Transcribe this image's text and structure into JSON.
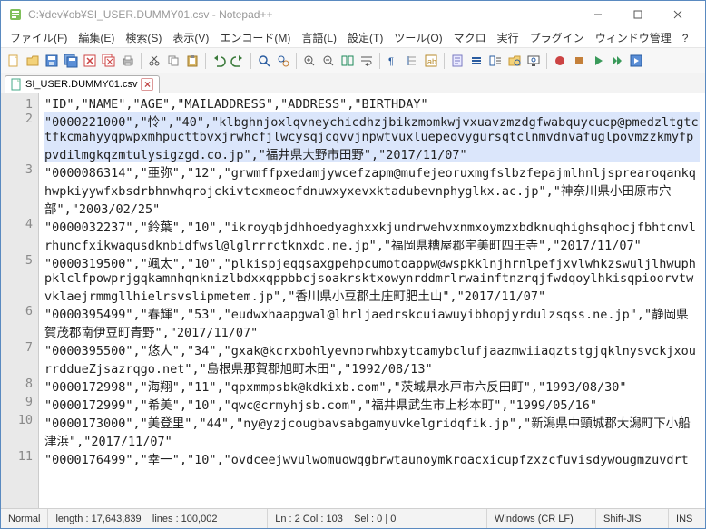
{
  "window": {
    "title": "C:¥dev¥ob¥SI_USER.DUMMY01.csv - Notepad++"
  },
  "menu": {
    "file": "ファイル(F)",
    "edit": "編集(E)",
    "search": "検索(S)",
    "view": "表示(V)",
    "encoding": "エンコード(M)",
    "language": "言語(L)",
    "settings": "設定(T)",
    "tools": "ツール(O)",
    "macro": "マクロ",
    "run": "実行",
    "plugins": "プラグイン",
    "window": "ウィンドウ管理",
    "help": "?"
  },
  "tab": {
    "name": "SI_USER.DUMMY01.csv"
  },
  "lines": [
    {
      "n": "1",
      "text": "\"ID\",\"NAME\",\"AGE\",\"MAILADDRESS\",\"ADDRESS\",\"BIRTHDAY\""
    },
    {
      "n": "2",
      "text": "\"0000221000\",\"怜\",\"40\",\"klbghnjoxlqvneychicdhzjbikzmomkwjvxuavzmzdgfwabquycucp@pmedzltgtctfkcmahyyqpwpxmhpucttbvxjrwhcfjlwcysqjcqvvjnpwtvuxluepeovygursqtclnmvdnvafuglpovmzzkmyfppvdilmgkqzmtulysigzgd.co.jp\",\"福井県大野市田野\",\"2017/11/07\"",
      "selected": true
    },
    {
      "n": "3",
      "text": "\"0000086314\",\"亜弥\",\"12\",\"grwmffpxedamjywcefzapm@mufejeoruxmgfslbzfepajmlhnljsprearoqankqhwpkiyywfxbsdrbhnwhqrojckivtcxmeocfdnuwxyxevxktadubevnphyglkx.ac.jp\",\"神奈川県小田原市穴部\",\"2003/02/25\""
    },
    {
      "n": "4",
      "text": "\"0000032237\",\"鈴葉\",\"10\",\"ikroyqbjdhhoedyaghxxkjundrwehvxnmxoymzxbdknuqhighsqhocjfbhtcnvlrhuncfxikwaqusdknbidfwsl@lglrrrctknxdc.ne.jp\",\"福岡県糟屋郡宇美町四王寺\",\"2017/11/07\""
    },
    {
      "n": "5",
      "text": "\"0000319500\",\"颯太\",\"10\",\"plkispjeqqsaxgpehpcumotoappw@wspkklnjhrnlpefjxvlwhkzswuljlhwuphpklclfpowprjgqkamnhqnknizlbdxxqppbbcjsoakrsktxowynrddmrlrwainftnzrqjfwdqoylhkisqpioorvtwvklaejrmmgllhielrsvslipmetem.jp\",\"香川県小豆郡土庄町肥土山\",\"2017/11/07\""
    },
    {
      "n": "6",
      "text": "\"0000395499\",\"春輝\",\"53\",\"eudwxhaapgwal@lhrljaedrskcuiawuyibhopjyrdulzsqss.ne.jp\",\"静岡県賀茂郡南伊豆町青野\",\"2017/11/07\""
    },
    {
      "n": "7",
      "text": "\"0000395500\",\"悠人\",\"34\",\"gxak@kcrxbohlyevnorwhbxytcamybclufjaazmwiiaqztstgjqklnysvckjxourrddueZjsazrqgo.net\",\"島根県那賀郡旭町木田\",\"1992/08/13\""
    },
    {
      "n": "8",
      "text": "\"0000172998\",\"海翔\",\"11\",\"qpxmmpsbk@kdkixb.com\",\"茨城県水戸市六反田町\",\"1993/08/30\""
    },
    {
      "n": "9",
      "text": "\"0000172999\",\"希美\",\"10\",\"qwc@crmyhjsb.com\",\"福井県武生市上杉本町\",\"1999/05/16\""
    },
    {
      "n": "10",
      "text": "\"0000173000\",\"美登里\",\"44\",\"ny@yzjcougbavsabgamyuvkelgridqfik.jp\",\"新潟県中頸城郡大潟町下小船津浜\",\"2017/11/07\""
    },
    {
      "n": "11",
      "text": "\"0000176499\",\"幸一\",\"10\",\"ovdceejwvulwomuowqgbrwtaunoymkroacxicupfzxzcfuvisdywougmzuvdrt"
    }
  ],
  "status": {
    "mode": "Normal",
    "length_label": "length : 17,643,839",
    "lines_label": "lines : 100,002",
    "ln_col": "Ln : 2    Col : 103",
    "sel": "Sel : 0 | 0",
    "eol": "Windows (CR LF)",
    "encoding": "Shift-JIS",
    "ovr": "INS"
  }
}
